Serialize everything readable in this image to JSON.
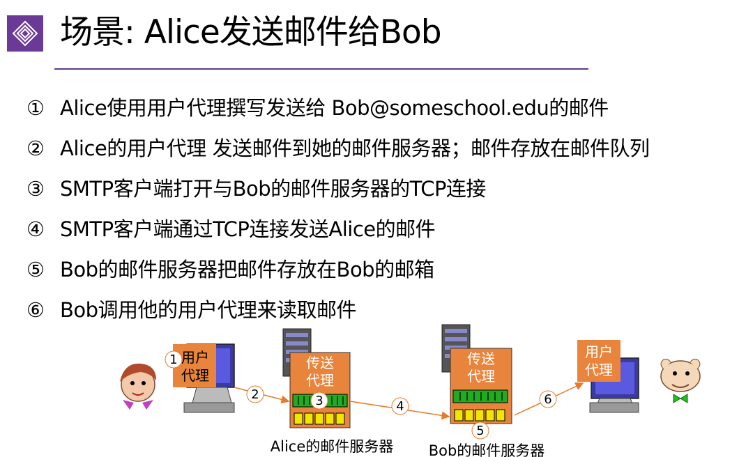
{
  "title": "场景: Alice发送邮件给Bob",
  "steps": [
    {
      "num": "①",
      "text": "Alice使用用户代理撰写发送给 Bob@someschool.edu的邮件"
    },
    {
      "num": "②",
      "text": "Alice的用户代理 发送邮件到她的邮件服务器；邮件存放在邮件队列"
    },
    {
      "num": "③",
      "text": "SMTP客户端打开与Bob的邮件服务器的TCP连接"
    },
    {
      "num": "④",
      "text": "SMTP客户端通过TCP连接发送Alice的邮件"
    },
    {
      "num": "⑤",
      "text": "Bob的邮件服务器把邮件存放在Bob的邮箱"
    },
    {
      "num": "⑥",
      "text": "Bob调用他的用户代理来读取邮件"
    }
  ],
  "diagram": {
    "alice_agent_line1": "用户",
    "alice_agent_line2": "代理",
    "alice_server_line1": "传送",
    "alice_server_line2": "代理",
    "bob_server_line1": "传送",
    "bob_server_line2": "代理",
    "bob_agent_line1": "用户",
    "bob_agent_line2": "代理",
    "alice_server_caption": "Alice的邮件服务器",
    "bob_server_caption": "Bob的邮件服务器",
    "step_markers": [
      "1",
      "2",
      "3",
      "4",
      "5",
      "6"
    ]
  },
  "colors": {
    "accent": "#5a3a86",
    "agent_box": "#e8843c",
    "queue_green": "#22aa22",
    "mailbox_yellow": "#f2e600",
    "arrow": "#e87a2a"
  }
}
